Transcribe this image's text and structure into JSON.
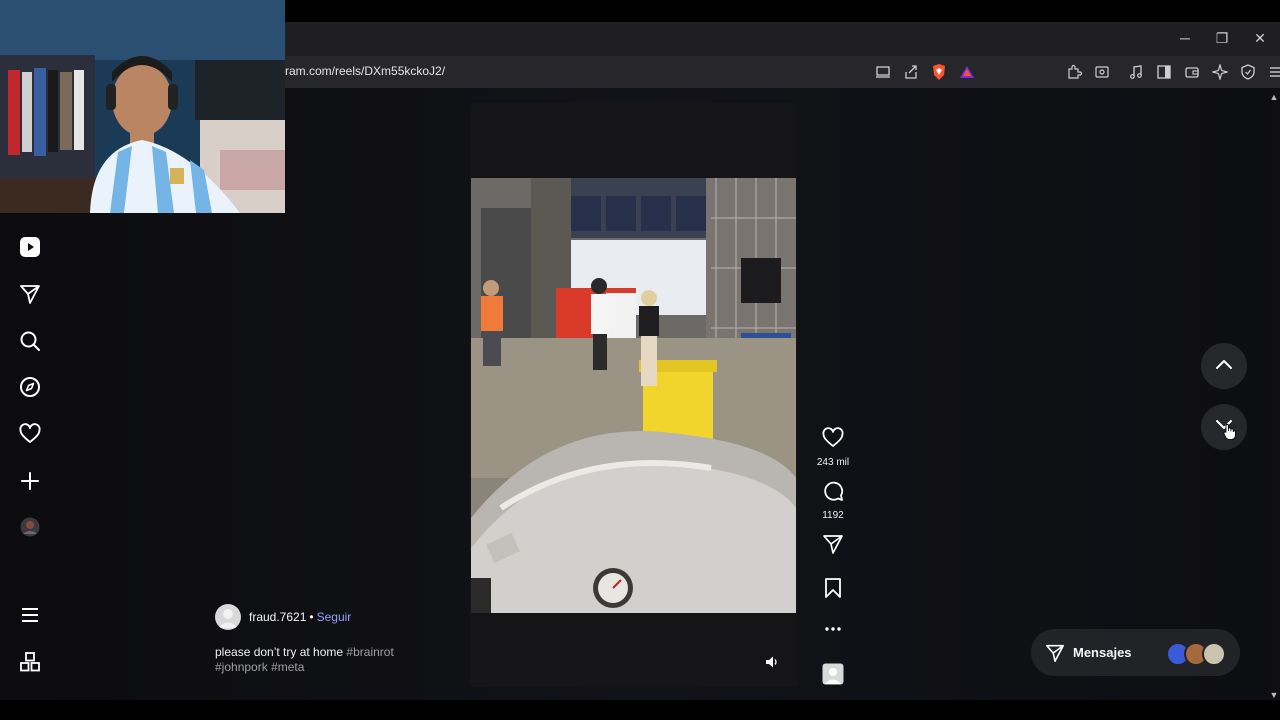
{
  "browser": {
    "url": "ram.com/reels/DXm55kckoJ2/",
    "window_controls": {
      "minimize": "─",
      "restore": "❐",
      "close": "✕"
    }
  },
  "sidebar": {
    "items": [
      {
        "icon": "reels-icon"
      },
      {
        "icon": "send-icon"
      },
      {
        "icon": "search-icon"
      },
      {
        "icon": "explore-icon"
      },
      {
        "icon": "heart-icon"
      },
      {
        "icon": "create-icon"
      },
      {
        "icon": "profile-avatar"
      },
      {
        "icon": "menu-icon"
      },
      {
        "icon": "apps-icon"
      }
    ]
  },
  "reel": {
    "author": "fraud.7621",
    "separator": "•",
    "follow_label": "Seguir",
    "caption_text": "please don’t try at home ",
    "hashtags": [
      "#brainrot",
      "#johnpork",
      "#meta"
    ],
    "likes": "243 mil",
    "comments": "1192"
  },
  "messages": {
    "label": "Mensajes"
  },
  "colors": {
    "accent_link": "#8ea1ff",
    "panel": "#222327",
    "background": "#0a0a0a"
  }
}
